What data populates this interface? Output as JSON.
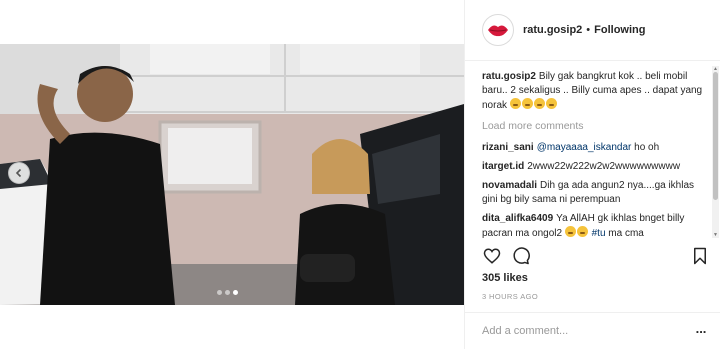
{
  "post": {
    "username": "ratu.gosip2",
    "separator": "•",
    "follow_status": "Following"
  },
  "caption": {
    "username": "ratu.gosip2",
    "text": "Bily gak bangkrut kok .. beli mobil baru.. 2 sekaligus .. Billy cuma apes .. dapat yang norak"
  },
  "load_more_label": "Load more comments",
  "comments": [
    {
      "username": "rizani_sani",
      "mention": "@mayaaaa_iskandar",
      "text": " ho oh"
    },
    {
      "username": "itarget.id",
      "mention": "",
      "text": "2www22w222w2w2wwwwwwwww"
    },
    {
      "username": "novamadali",
      "mention": "",
      "text": "Dih ga ada angun2 nya....ga ikhlas gini bg bily sama ni perempuan"
    },
    {
      "username": "dita_alifka6409",
      "mention": "",
      "text": "Ya AllAH gk ikhlas bnget billy pacran ma ongol2",
      "hashtag": "#tu",
      "tail": " ma cma"
    }
  ],
  "likes": "305 likes",
  "time_ago": "3 HOURS AGO",
  "add_comment_placeholder": "Add a comment...",
  "more_label": "...",
  "colors": {
    "text": "#262626",
    "muted": "#999999",
    "link": "#003569",
    "divider": "#efefef"
  },
  "icons": {
    "like": "heart-outline-icon",
    "comment": "speech-bubble-icon",
    "save": "bookmark-outline-icon",
    "prev": "chevron-left-icon"
  },
  "carousel": {
    "count": 3,
    "active": 3
  }
}
